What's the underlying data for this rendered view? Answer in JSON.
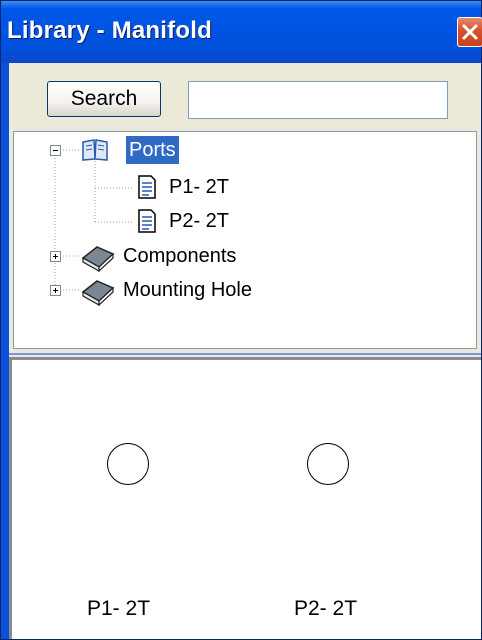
{
  "window": {
    "title": "Library - Manifold",
    "close_icon": "close-icon"
  },
  "search": {
    "button_label": "Search",
    "value": "",
    "placeholder": ""
  },
  "tree": {
    "root_nodes": [
      {
        "label": "Ports",
        "icon": "open-book-icon",
        "expanded": true,
        "selected": true,
        "children": [
          {
            "label": "P1- 2T",
            "icon": "document-icon"
          },
          {
            "label": "P2- 2T",
            "icon": "document-icon"
          }
        ]
      },
      {
        "label": "Components",
        "icon": "closed-book-icon",
        "expanded": false
      },
      {
        "label": "Mounting Hole",
        "icon": "closed-book-icon",
        "expanded": false
      }
    ]
  },
  "preview": {
    "items": [
      {
        "label": "P1- 2T",
        "shape": "circle"
      },
      {
        "label": "P2- 2T",
        "shape": "circle"
      }
    ]
  },
  "colors": {
    "titlebar": "#0054e3",
    "selection": "#316ac5",
    "close_button": "#d7502c",
    "window_face": "#ece9d8"
  }
}
